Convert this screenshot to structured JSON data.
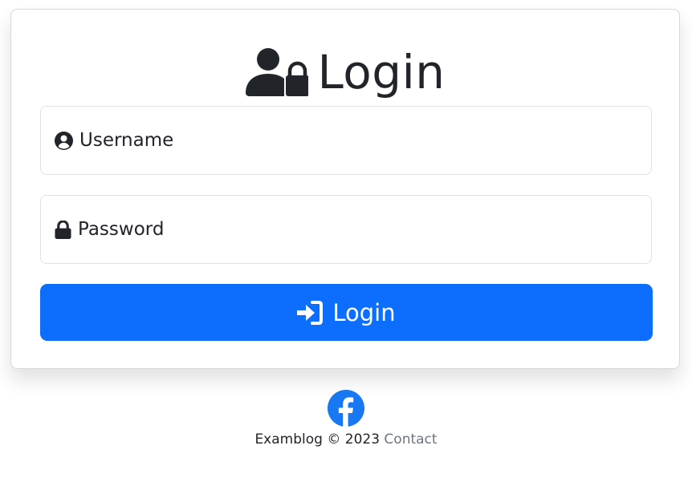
{
  "header": {
    "title": "Login",
    "icon": "user-lock-icon"
  },
  "form": {
    "username_label": "Username",
    "username_icon": "user-circle-icon",
    "password_label": "Password",
    "password_icon": "lock-icon",
    "submit_label": "Login",
    "submit_icon": "sign-in-icon"
  },
  "footer": {
    "social_icon": "facebook-icon",
    "site_name": "Examblog",
    "copyright": "©",
    "year": "2023",
    "contact_label": "Contact"
  },
  "colors": {
    "primary": "#0d6efd",
    "text": "#212529",
    "muted": "#6c757d",
    "facebook": "#1877f2"
  }
}
